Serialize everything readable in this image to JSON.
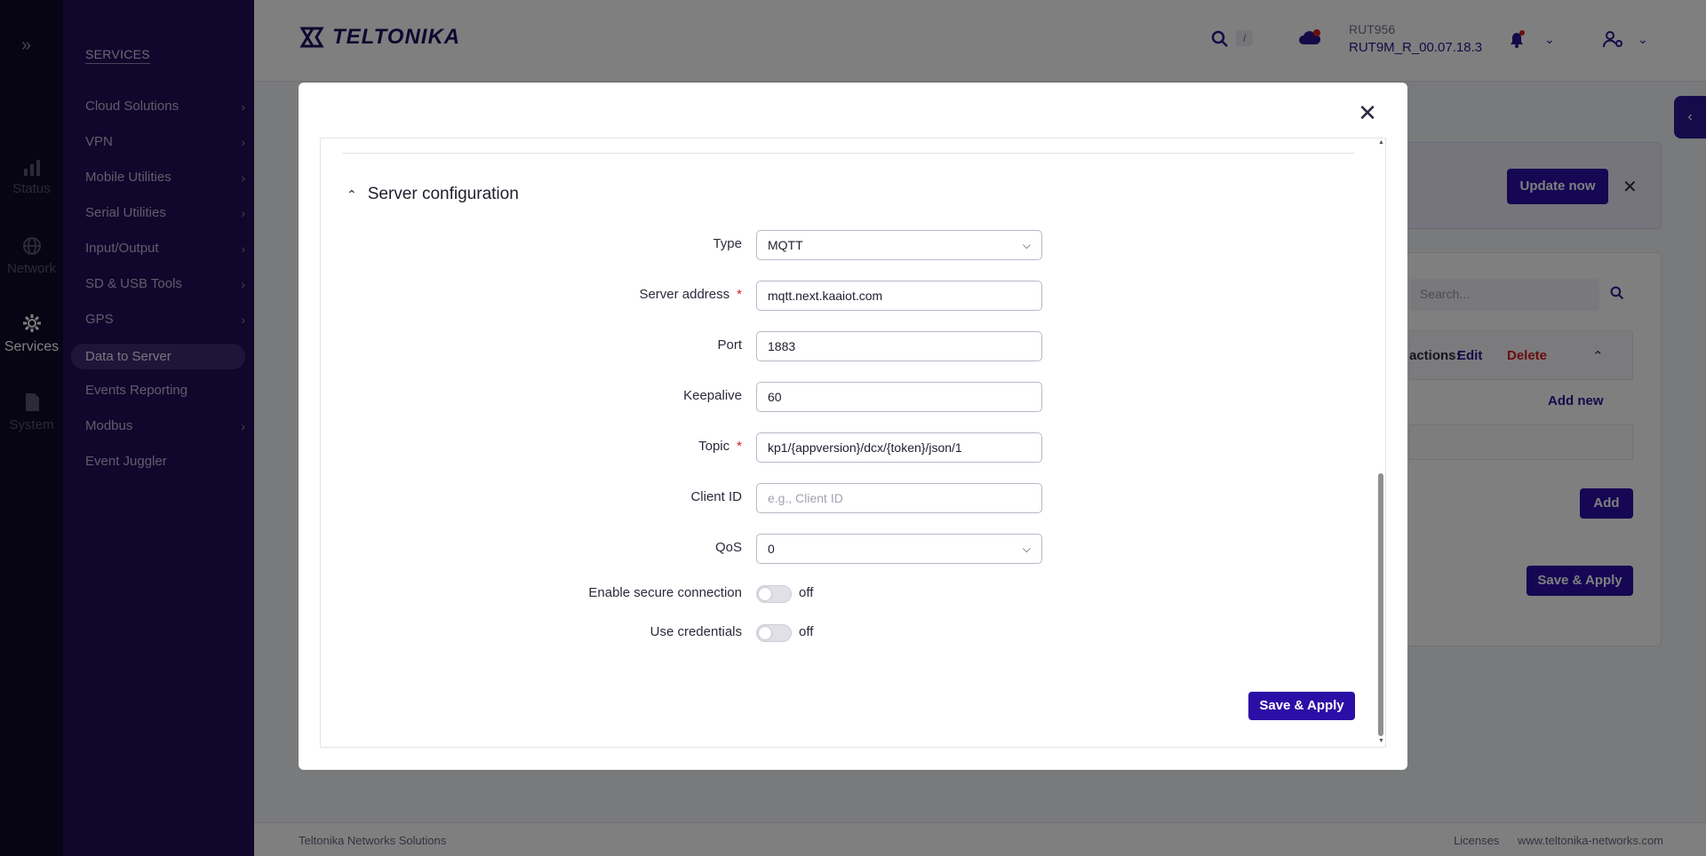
{
  "rail": {
    "items": [
      {
        "label": "Status"
      },
      {
        "label": "Network"
      },
      {
        "label": "Services"
      },
      {
        "label": "System"
      }
    ]
  },
  "menu": {
    "title": "SERVICES",
    "items": [
      {
        "label": "Cloud Solutions"
      },
      {
        "label": "VPN"
      },
      {
        "label": "Mobile Utilities"
      },
      {
        "label": "Serial Utilities"
      },
      {
        "label": "Input/Output"
      },
      {
        "label": "SD & USB Tools"
      },
      {
        "label": "GPS"
      },
      {
        "label": "Data to Server"
      },
      {
        "label": "Events Reporting"
      },
      {
        "label": "Modbus"
      },
      {
        "label": "Event Juggler"
      }
    ]
  },
  "header": {
    "logo": "TELTONIKA",
    "search_shortcut": "/",
    "device_model": "RUT956",
    "firmware": "RUT9M_R_00.07.18.3"
  },
  "background": {
    "update_button": "Update now",
    "search_placeholder": "Search...",
    "actions_label": "actions:",
    "edit_label": "Edit",
    "delete_label": "Delete",
    "add_new_label": "Add new",
    "add_button": "Add",
    "save_apply": "Save & Apply"
  },
  "footer": {
    "left": "Teltonika Networks Solutions",
    "licenses": "Licenses",
    "site": "www.teltonika-networks.com"
  },
  "modal": {
    "section_title": "Server configuration",
    "fields": {
      "type": {
        "label": "Type",
        "value": "MQTT"
      },
      "server_address": {
        "label": "Server address",
        "value": "mqtt.next.kaaiot.com"
      },
      "port": {
        "label": "Port",
        "value": "1883"
      },
      "keepalive": {
        "label": "Keepalive",
        "value": "60"
      },
      "topic": {
        "label": "Topic",
        "value": "kp1/{appversion}/dcx/{token}/json/1"
      },
      "client_id": {
        "label": "Client ID",
        "value": "",
        "placeholder": "e.g., Client ID"
      },
      "qos": {
        "label": "QoS",
        "value": "0"
      },
      "secure": {
        "label": "Enable secure connection",
        "state": "off"
      },
      "credentials": {
        "label": "Use credentials",
        "state": "off"
      }
    },
    "required_mark": "*",
    "apply_button": "Save & Apply"
  }
}
